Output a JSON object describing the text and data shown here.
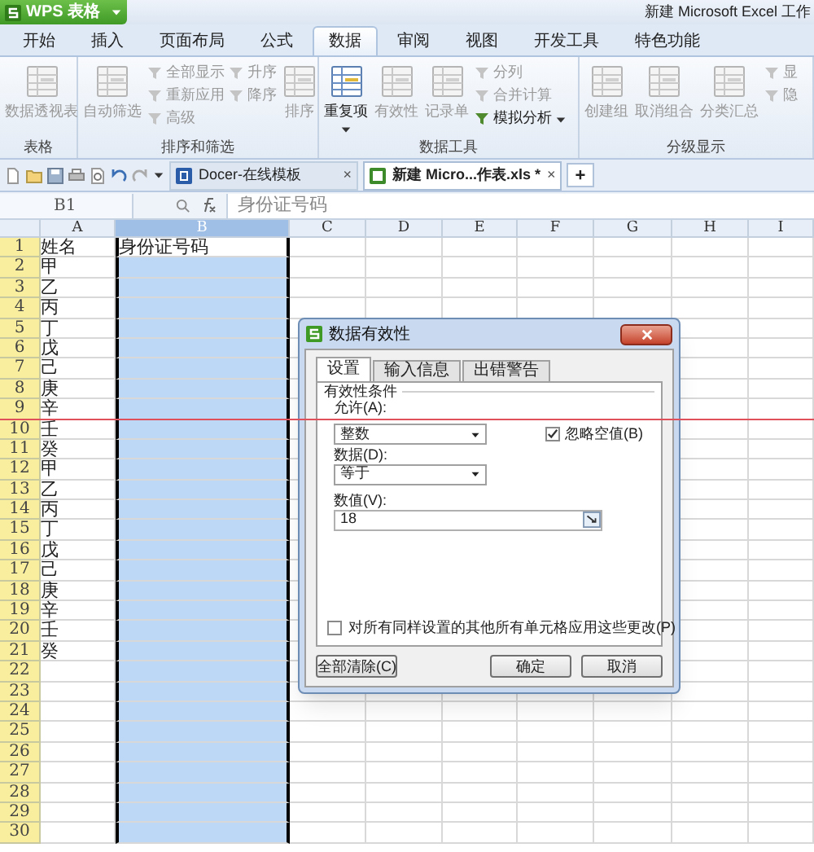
{
  "app_button": {
    "label": "WPS 表格"
  },
  "window": {
    "title": "新建 Microsoft Excel 工作"
  },
  "tabs": [
    {
      "label": "开始",
      "selected": false
    },
    {
      "label": "插入",
      "selected": false
    },
    {
      "label": "页面布局",
      "selected": false
    },
    {
      "label": "公式",
      "selected": false
    },
    {
      "label": "数据",
      "selected": true
    },
    {
      "label": "审阅",
      "selected": false
    },
    {
      "label": "视图",
      "selected": false
    },
    {
      "label": "开发工具",
      "selected": false
    },
    {
      "label": "特色功能",
      "selected": false
    }
  ],
  "ribbon_groups": [
    {
      "label": "表格",
      "columns": [
        [
          {
            "kind": "large",
            "label": "数据透视表",
            "disabled": true
          }
        ]
      ]
    },
    {
      "label": "排序和筛选",
      "columns": [
        [
          {
            "kind": "large",
            "label": "自动筛选",
            "disabled": true
          }
        ],
        [
          {
            "kind": "small",
            "label": "全部显示",
            "disabled": true
          },
          {
            "kind": "small",
            "label": "重新应用",
            "disabled": true
          },
          {
            "kind": "small",
            "label": "高级",
            "disabled": true
          }
        ],
        [
          {
            "kind": "small",
            "label": "升序",
            "disabled": true
          },
          {
            "kind": "small",
            "label": "降序",
            "disabled": true
          }
        ],
        [
          {
            "kind": "large",
            "label": "排序",
            "disabled": true
          }
        ]
      ]
    },
    {
      "label": "数据工具",
      "columns": [
        [
          {
            "kind": "large",
            "label": "重复项",
            "disabled": false,
            "dropdown": true
          }
        ],
        [
          {
            "kind": "large",
            "label": "有效性",
            "disabled": true
          }
        ],
        [
          {
            "kind": "large",
            "label": "记录单",
            "disabled": true
          }
        ],
        [
          {
            "kind": "small",
            "label": "分列",
            "disabled": true
          },
          {
            "kind": "small",
            "label": "合并计算",
            "disabled": true
          },
          {
            "kind": "small",
            "label": "模拟分析",
            "disabled": false,
            "dropdown": true
          }
        ]
      ]
    },
    {
      "label": "分级显示",
      "columns": [
        [
          {
            "kind": "large",
            "label": "创建组",
            "disabled": true
          }
        ],
        [
          {
            "kind": "large",
            "label": "取消组合",
            "disabled": true
          }
        ],
        [
          {
            "kind": "large",
            "label": "分类汇总",
            "disabled": true
          }
        ],
        [
          {
            "kind": "small",
            "label": "显",
            "disabled": true
          },
          {
            "kind": "small",
            "label": "隐",
            "disabled": true
          }
        ]
      ]
    }
  ],
  "doc_tabs": [
    {
      "label": "Docer-在线模板",
      "selected": false,
      "close": "×"
    },
    {
      "label": "新建 Micro...作表.xls *",
      "selected": true,
      "close": "×"
    }
  ],
  "new_tab": "+",
  "formula_bar": {
    "name_box": "B1",
    "formula": "身份证号码"
  },
  "sheet": {
    "columns": [
      {
        "label": "A",
        "selected": false
      },
      {
        "label": "B",
        "selected": true
      },
      {
        "label": "C",
        "selected": false
      },
      {
        "label": "D",
        "selected": false
      },
      {
        "label": "E",
        "selected": false
      },
      {
        "label": "F",
        "selected": false
      },
      {
        "label": "G",
        "selected": false
      },
      {
        "label": "H",
        "selected": false
      },
      {
        "label": "I",
        "selected": false
      }
    ],
    "rows": [
      {
        "header": "1",
        "cells": [
          "姓名",
          "身份证号码"
        ],
        "active": true
      },
      {
        "header": "2",
        "cells": [
          "甲"
        ],
        "active": false
      },
      {
        "header": "3",
        "cells": [
          "乙"
        ],
        "active": false
      },
      {
        "header": "4",
        "cells": [
          "丙"
        ],
        "active": false
      },
      {
        "header": "5",
        "cells": [
          "丁"
        ],
        "active": false
      },
      {
        "header": "6",
        "cells": [
          "戊"
        ],
        "active": false
      },
      {
        "header": "7",
        "cells": [
          "己"
        ],
        "active": false
      },
      {
        "header": "8",
        "cells": [
          "庚"
        ],
        "active": false
      },
      {
        "header": "9",
        "cells": [
          "辛"
        ],
        "active": false
      },
      {
        "header": "10",
        "cells": [
          "壬"
        ],
        "active": false
      },
      {
        "header": "11",
        "cells": [
          "癸"
        ],
        "active": false
      },
      {
        "header": "12",
        "cells": [
          "甲"
        ],
        "active": false
      },
      {
        "header": "13",
        "cells": [
          "乙"
        ],
        "active": false
      },
      {
        "header": "14",
        "cells": [
          "丙"
        ],
        "active": false
      },
      {
        "header": "15",
        "cells": [
          "丁"
        ],
        "active": false
      },
      {
        "header": "16",
        "cells": [
          "戊"
        ],
        "active": false
      },
      {
        "header": "17",
        "cells": [
          "己"
        ],
        "active": false
      },
      {
        "header": "18",
        "cells": [
          "庚"
        ],
        "active": false
      },
      {
        "header": "19",
        "cells": [
          "辛"
        ],
        "active": false
      },
      {
        "header": "20",
        "cells": [
          "壬"
        ],
        "active": false
      },
      {
        "header": "21",
        "cells": [
          "癸"
        ],
        "active": false
      },
      {
        "header": "22",
        "active": false
      },
      {
        "header": "23",
        "active": false
      },
      {
        "header": "24",
        "active": false
      },
      {
        "header": "25",
        "active": false
      },
      {
        "header": "26",
        "active": false
      },
      {
        "header": "27",
        "active": false
      },
      {
        "header": "28",
        "active": false
      },
      {
        "header": "29",
        "active": false
      },
      {
        "header": "30",
        "active": false
      }
    ]
  },
  "dialog": {
    "title": "数据有效性",
    "tabs": [
      {
        "label": "设置",
        "selected": true
      },
      {
        "label": "输入信息",
        "selected": false
      },
      {
        "label": "出错警告",
        "selected": false
      }
    ],
    "group_label": "有效性条件",
    "allow": {
      "label": "允许(A):",
      "value": "整数"
    },
    "ignore_blank": {
      "label": "忽略空值(B)",
      "checked": true
    },
    "data": {
      "label": "数据(D):",
      "value": "等于"
    },
    "number": {
      "label": "数值(V):",
      "value": "18"
    },
    "apply_all": {
      "label": "对所有同样设置的其他所有单元格应用这些更改(P)",
      "checked": false
    },
    "buttons": [
      {
        "label": "全部清除(C)",
        "kind": "left"
      },
      {
        "label": "确定",
        "kind": "default"
      },
      {
        "label": "取消",
        "kind": "normal"
      }
    ]
  }
}
